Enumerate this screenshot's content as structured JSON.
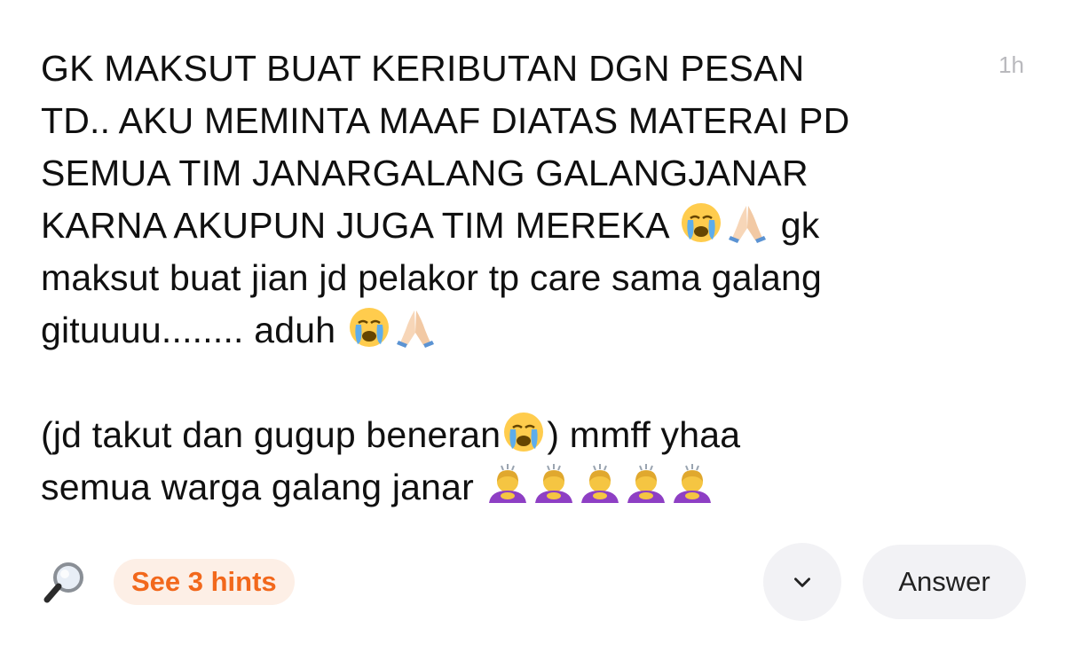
{
  "post": {
    "timestamp": "1h",
    "paragraphs": [
      {
        "lines": [
          "GK MAKSUT BUAT KERIBUTAN DGN PESAN",
          "TD.. AKU MEMINTA MAAF DIATAS MATERAI PD",
          "SEMUA TIM JANARGALANG GALANGJANAR",
          "KARNA AKUPUN JUGA TIM MEREKA ",
          " gk",
          "maksut buat jian jd pelakor tp care sama galang",
          "gituuuu........ aduh "
        ]
      },
      {
        "lines": [
          "(jd takut dan gugup beneran",
          ") mmff yhaa",
          "semua warga galang janar "
        ]
      }
    ],
    "emoji_icons": [
      "loudly-crying-face",
      "folded-hands",
      "woman-bowing"
    ]
  },
  "footer": {
    "hints_label": "See 3 hints",
    "answer_label": "Answer",
    "search_icon": "magnifying-glass",
    "expand_icon": "chevron-down"
  },
  "colors": {
    "accent": "#f2681c",
    "hint_bg": "#fdefe6",
    "button_bg": "#f2f2f5",
    "timestamp": "#b9b9bd"
  }
}
